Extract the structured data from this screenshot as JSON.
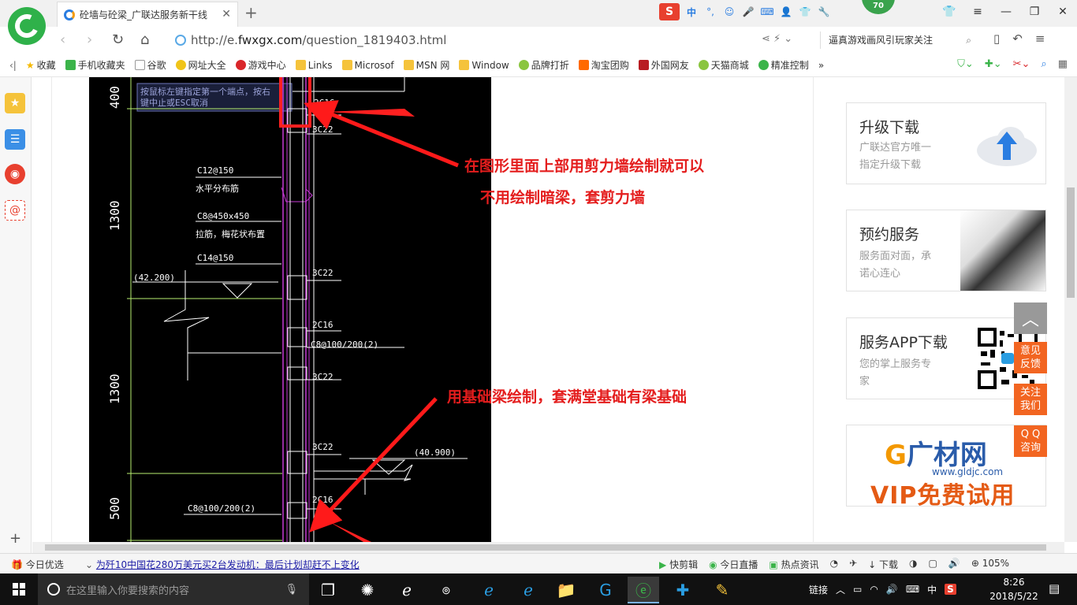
{
  "browser": {
    "tab_title": "砼墙与砼梁_广联达服务新干线",
    "url_prefix": "http://e.",
    "url_host": "fwxgx.com",
    "url_path": "/question_1819403.html",
    "search_text": "逼真游戏画风引玩家关注",
    "badge_count": "70",
    "ime_labels": {
      "sogou": "S",
      "lang": "中",
      "punct": "°,"
    }
  },
  "bookmarks": [
    {
      "label": "收藏",
      "icon": "star-icon"
    },
    {
      "label": "手机收藏夹",
      "icon": "phone-icon"
    },
    {
      "label": "谷歌",
      "icon": "page-icon"
    },
    {
      "label": "网址大全",
      "icon": "globe-icon"
    },
    {
      "label": "游戏中心",
      "icon": "game-icon"
    },
    {
      "label": "Links",
      "icon": "folder-icon"
    },
    {
      "label": "Microsof",
      "icon": "folder-icon"
    },
    {
      "label": "MSN 网",
      "icon": "folder-icon"
    },
    {
      "label": "Window",
      "icon": "folder-icon"
    },
    {
      "label": "品牌打折",
      "icon": "leaf-icon"
    },
    {
      "label": "淘宝团购",
      "icon": "taobao-icon"
    },
    {
      "label": "外国网友",
      "icon": "flag-icon"
    },
    {
      "label": "天猫商城",
      "icon": "leaf-icon"
    },
    {
      "label": "精准控制",
      "icon": "chat-icon"
    }
  ],
  "cad": {
    "prompt_line1": "按鼠标左键指定第一个端点，按右",
    "prompt_line2": "键中止或ESC取消",
    "dims": [
      "400",
      "1300",
      "1300",
      "500"
    ],
    "labels": {
      "c16_top": "2C16",
      "c22_1": "3C22",
      "c12": "C12@150",
      "hdist": "水平分布筋",
      "c8_450": "C8@450x450",
      "lajin": "拉筋，梅花状布置",
      "c14": "C14@150",
      "elev1": "(42.200)",
      "c22_2": "3C22",
      "c16_mid": "2C16",
      "c8_100": "C8@100/200(2)",
      "c22_3": "3C22",
      "c22_4": "3C22",
      "elev2": "(40.900)",
      "c8_bottom": "C8@100/200(2)",
      "c16_bottom": "2C16"
    }
  },
  "annotations": {
    "top_line1": "在图形里面上部用剪力墙绘制就可以",
    "top_line2": "不用绘制暗梁，套剪力墙",
    "bottom": "用基础梁绘制，套满堂基础有梁基础"
  },
  "cards": [
    {
      "title": "升级下载",
      "desc1": "广联达官方唯一",
      "desc2": "指定升级下载"
    },
    {
      "title": "预约服务",
      "desc1": "服务面对面，承",
      "desc2": "诺心连心"
    },
    {
      "title": "服务APP下载",
      "desc1": "您的掌上服务专",
      "desc2": "家"
    }
  ],
  "ad": {
    "logo_text": "广材网",
    "domain": "www.gldjc.com",
    "vip": "VIP免费试用"
  },
  "float_buttons": [
    {
      "line1": "意见",
      "line2": "反馈"
    },
    {
      "line1": "关注",
      "line2": "我们"
    },
    {
      "line1": "Q Q",
      "line2": "咨询"
    }
  ],
  "statusbar": {
    "today": "今日优选",
    "news": "为歼10中国花280万美元买2台发动机：最后计划却赶不上变化",
    "items": [
      "快剪辑",
      "今日直播",
      "热点资讯",
      "下载",
      "105%"
    ]
  },
  "taskbar": {
    "search_placeholder": "在这里输入你要搜索的内容",
    "tray_label": "链接",
    "ime": "中",
    "time": "8:26",
    "date": "2018/5/22"
  },
  "colors": {
    "annotation_red": "#e41d1d",
    "cad_magenta": "#c73bd6",
    "cad_green": "#b8f070",
    "float_orange": "#f26521"
  }
}
